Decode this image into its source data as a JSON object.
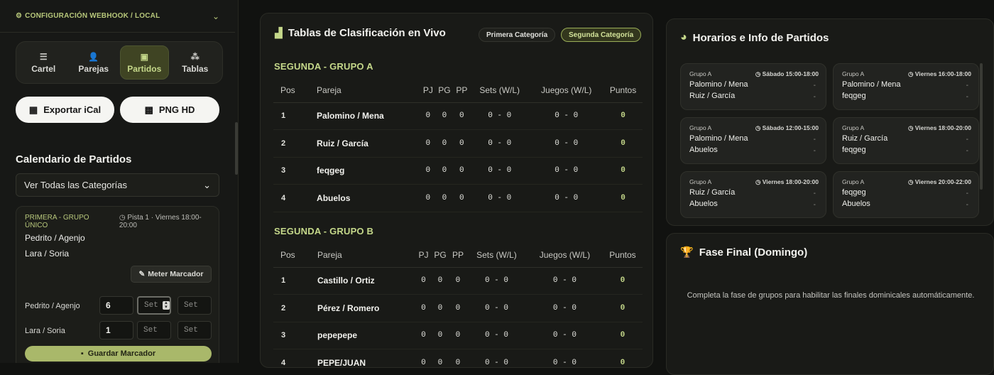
{
  "sidebar": {
    "webhook_title": "CONFIGURACIÓN WEBHOOK / LOCAL",
    "nav": [
      {
        "label": "Cartel",
        "icon": "sliders-icon"
      },
      {
        "label": "Parejas",
        "icon": "user-plus-icon"
      },
      {
        "label": "Partidos",
        "icon": "calendar-icon",
        "active": true
      },
      {
        "label": "Tablas",
        "icon": "sitemap-icon"
      }
    ],
    "export_ical": "Exportar iCal",
    "png_hd": "PNG HD",
    "calendar_title": "Calendario de Partidos",
    "category_select": "Ver Todas las Categorías",
    "match": {
      "category": "PRIMERA - GRUPO ÚNICO",
      "meta": "Pista 1 · Viernes 18:00-20:00",
      "team_a": "Pedrito / Agenjo",
      "team_b": "Lara / Soria",
      "meter_label": "Meter Marcador",
      "score_a_label": "Pedrito / Agenjo",
      "score_b_label": "Lara / Soria",
      "score_a": [
        "6",
        "Set",
        "Set"
      ],
      "score_b": [
        "1",
        "Set",
        "Set"
      ],
      "save_label": "Guardar Marcador"
    }
  },
  "standings": {
    "title": "Tablas de Clasificación en Vivo",
    "tabs": [
      "Primera Categoría",
      "Segunda Categoría"
    ],
    "headers": [
      "Pos",
      "Pareja",
      "PJ",
      "PG",
      "PP",
      "Sets (W/L)",
      "Juegos (W/L)",
      "Puntos"
    ],
    "groups": [
      {
        "title": "SEGUNDA - GRUPO A",
        "rows": [
          [
            "1",
            "Palomino / Mena",
            "0",
            "0",
            "0",
            "0 - 0",
            "0 - 0",
            "0"
          ],
          [
            "2",
            "Ruiz / García",
            "0",
            "0",
            "0",
            "0 - 0",
            "0 - 0",
            "0"
          ],
          [
            "3",
            "feqgeg",
            "0",
            "0",
            "0",
            "0 - 0",
            "0 - 0",
            "0"
          ],
          [
            "4",
            "Abuelos",
            "0",
            "0",
            "0",
            "0 - 0",
            "0 - 0",
            "0"
          ]
        ]
      },
      {
        "title": "SEGUNDA - GRUPO B",
        "rows": [
          [
            "1",
            "Castillo / Ortiz",
            "0",
            "0",
            "0",
            "0 - 0",
            "0 - 0",
            "0"
          ],
          [
            "2",
            "Pérez / Romero",
            "0",
            "0",
            "0",
            "0 - 0",
            "0 - 0",
            "0"
          ],
          [
            "3",
            "pepepepe",
            "0",
            "0",
            "0",
            "0 - 0",
            "0 - 0",
            "0"
          ],
          [
            "4",
            "PEPE/JUAN",
            "0",
            "0",
            "0",
            "0 - 0",
            "0 - 0",
            "0"
          ]
        ]
      }
    ]
  },
  "schedule": {
    "title": "Horarios e Info de Partidos",
    "cards": [
      {
        "group": "Grupo A",
        "time": "Sábado 15:00-18:00",
        "a": "Palomino / Mena",
        "b": "Ruiz / García"
      },
      {
        "group": "Grupo A",
        "time": "Viernes 16:00-18:00",
        "a": "Palomino / Mena",
        "b": "feqgeg"
      },
      {
        "group": "Grupo A",
        "time": "Sábado 12:00-15:00",
        "a": "Palomino / Mena",
        "b": "Abuelos"
      },
      {
        "group": "Grupo A",
        "time": "Viernes 18:00-20:00",
        "a": "Ruiz / García",
        "b": "feqgeg"
      },
      {
        "group": "Grupo A",
        "time": "Viernes 18:00-20:00",
        "a": "Ruiz / García",
        "b": "Abuelos"
      },
      {
        "group": "Grupo A",
        "time": "Viernes 20:00-22:00",
        "a": "feqgeg",
        "b": "Abuelos"
      }
    ],
    "dash": "-"
  },
  "final": {
    "title": "Fase Final (Domingo)",
    "text": "Completa la fase de grupos para habilitar las finales dominicales automáticamente."
  },
  "colors": {
    "accent": "#c5d88a",
    "accent_button": "#a9b86a",
    "background": "#111210"
  }
}
